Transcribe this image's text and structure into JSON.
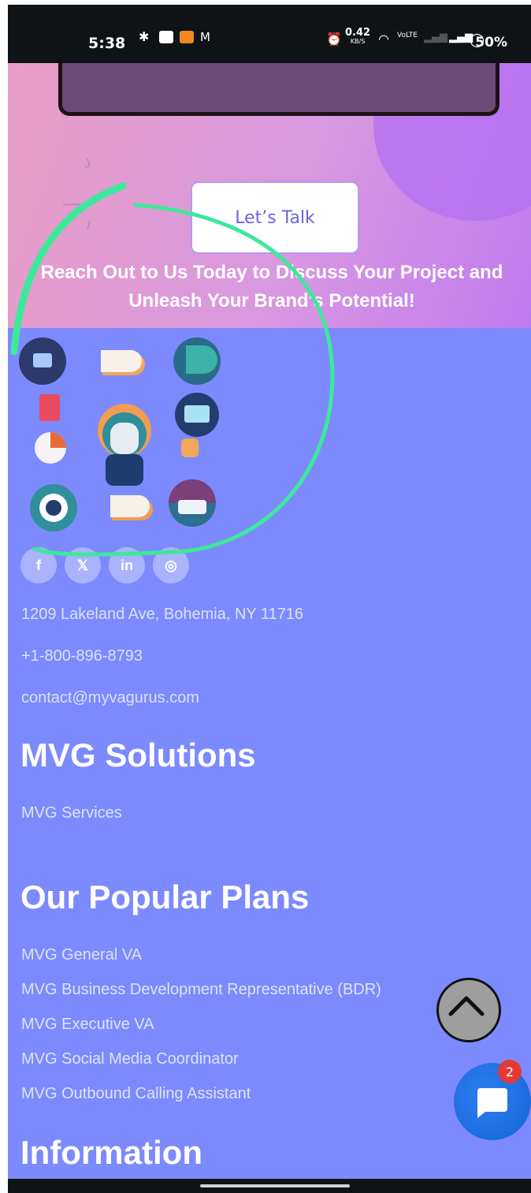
{
  "status_bar": {
    "time": "5:38",
    "net_speed": "0.42",
    "net_unit": "KB/S",
    "battery": "50%"
  },
  "hero": {
    "cta_label": "Let’s Talk",
    "tagline": "Reach Out to Us Today to Discuss Your Project and Unleash Your Brand's Potential!"
  },
  "social": {
    "facebook": "f",
    "x": "𝕏",
    "linkedin": "in",
    "instagram": "◎"
  },
  "contact": {
    "address": "1209 Lakeland Ave, Bohemia, NY 11716",
    "phone": "+1-800-896-8793",
    "email": "contact@myvagurus.com"
  },
  "solutions": {
    "heading": "MVG Solutions",
    "links": [
      "MVG Services"
    ]
  },
  "plans": {
    "heading": "Our Popular Plans",
    "links": [
      "MVG General VA",
      "MVG Business Development Representative (BDR)",
      "MVG Executive VA",
      "MVG Social Media Coordinator",
      "MVG Outbound Calling Assistant"
    ]
  },
  "information": {
    "heading": "Information"
  },
  "chat": {
    "badge_count": "2"
  },
  "colors": {
    "footer_bg": "#7c8afd",
    "hero_pink": "#e89ec4",
    "hero_purple": "#c07af0",
    "annotation_green": "#3ee89a",
    "chat_blue": "#1565d6"
  }
}
